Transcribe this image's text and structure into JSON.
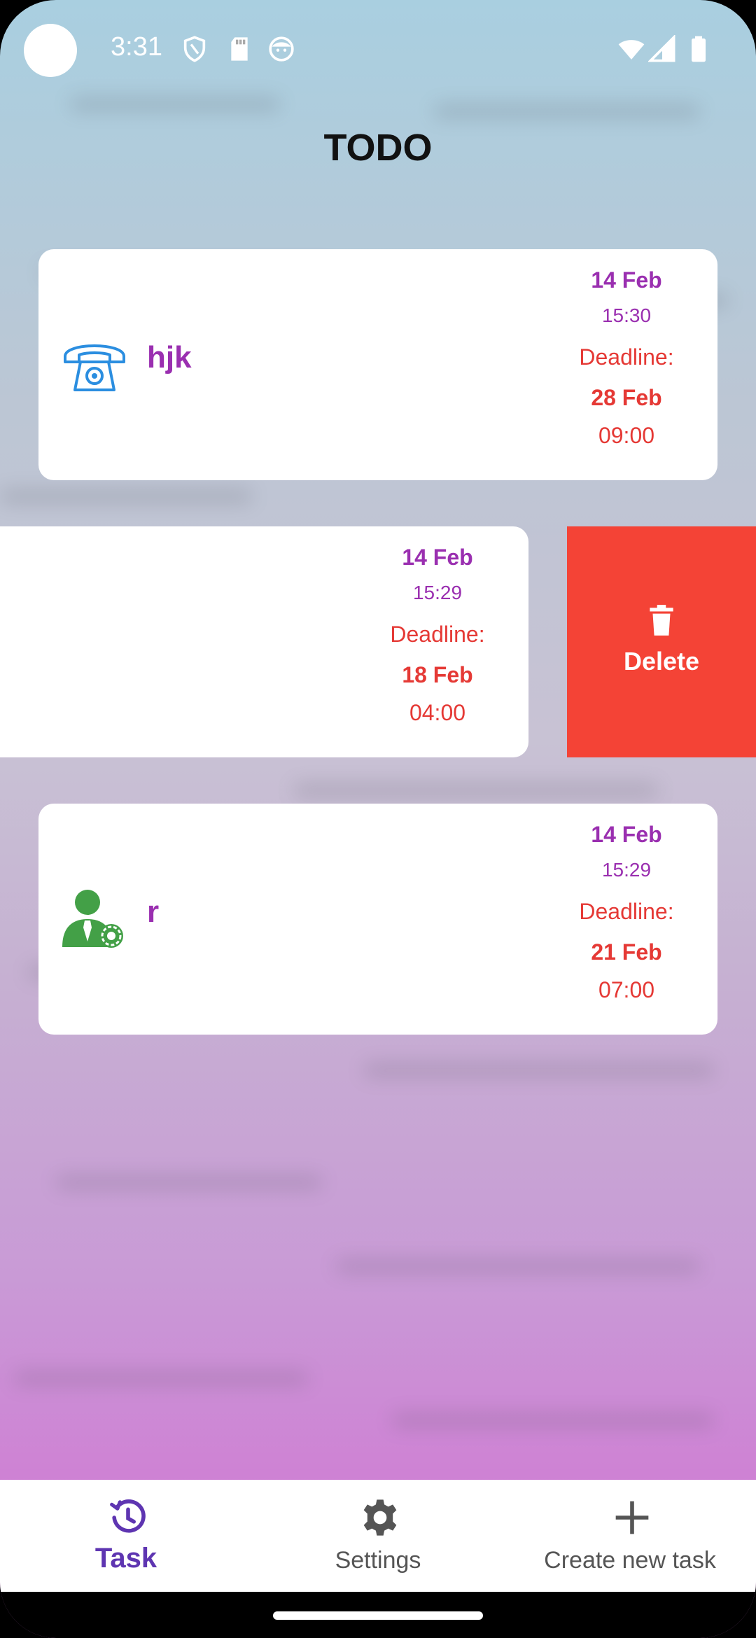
{
  "status_bar": {
    "time": "3:31",
    "icons_left": [
      "shield-icon",
      "sd-card-icon",
      "face-icon"
    ],
    "icons_right": [
      "wifi-icon",
      "signal-icon",
      "battery-icon"
    ]
  },
  "app": {
    "title": "TODO"
  },
  "tasks": [
    {
      "icon": "telephone-icon",
      "title": "hjk",
      "created_date": "14 Feb",
      "created_time": "15:30",
      "deadline_label": "Deadline:",
      "deadline_date": "28 Feb",
      "deadline_time": "09:00"
    },
    {
      "icon": "",
      "title": "",
      "created_date": "14 Feb",
      "created_time": "15:29",
      "deadline_label": "Deadline:",
      "deadline_date": "18 Feb",
      "deadline_time": "04:00"
    },
    {
      "icon": "manager-icon",
      "title": "r",
      "created_date": "14 Feb",
      "created_time": "15:29",
      "deadline_label": "Deadline:",
      "deadline_date": "21 Feb",
      "deadline_time": "07:00"
    }
  ],
  "swipe_action": {
    "icon": "trash-icon",
    "label": "Delete",
    "color": "#f44336"
  },
  "bottom_nav": {
    "items": [
      {
        "label": "Task",
        "icon": "clock-history-icon",
        "active": true
      },
      {
        "label": "Settings",
        "icon": "gear-icon",
        "active": false
      },
      {
        "label": "Create new task",
        "icon": "plus-icon",
        "active": false
      }
    ],
    "active_color": "#5e35b1"
  },
  "colors": {
    "title_purple": "#9a2fb0",
    "deadline_red": "#e53935"
  }
}
